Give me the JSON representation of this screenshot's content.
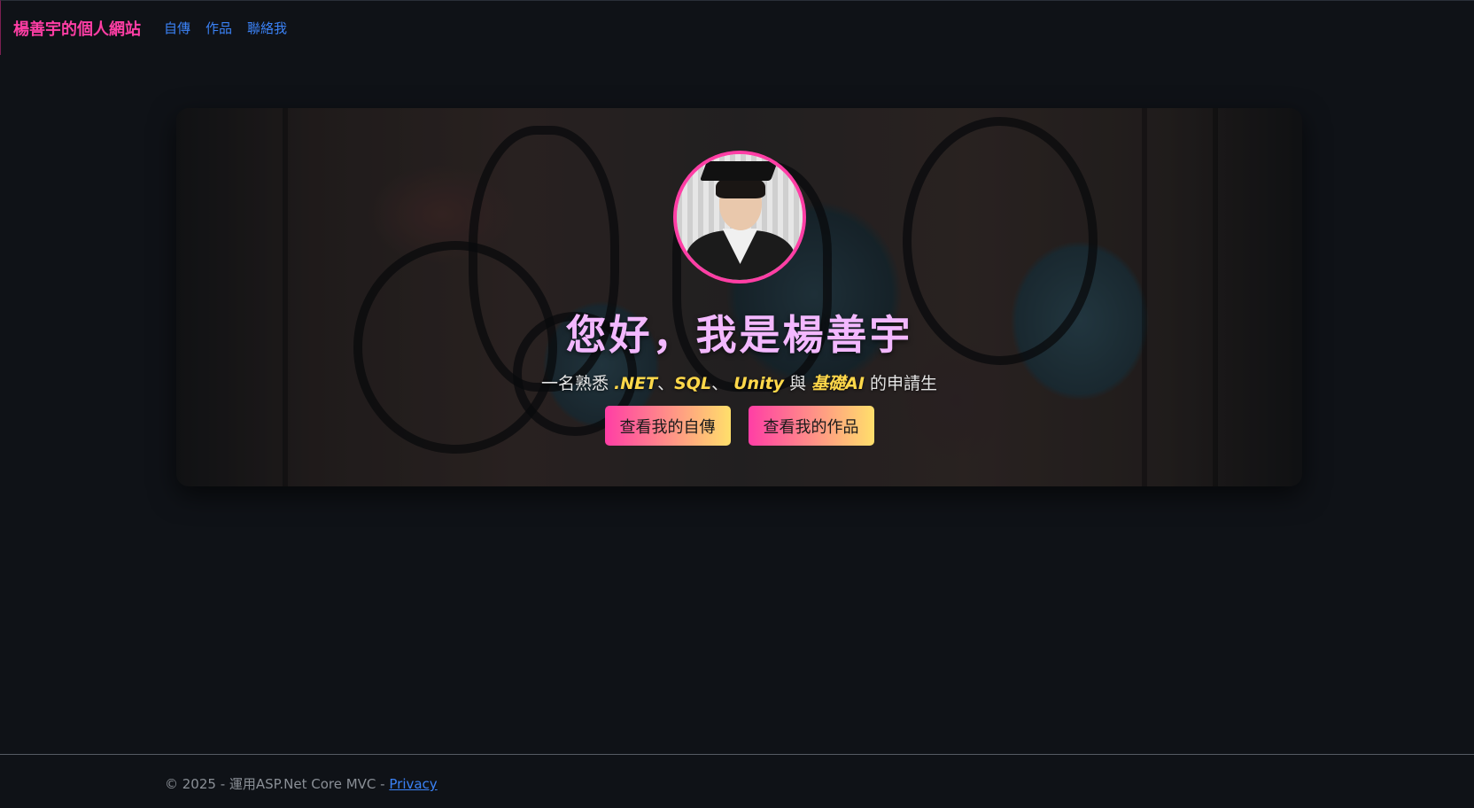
{
  "navbar": {
    "brand": "楊善宇的個人網站",
    "links": [
      "自傳",
      "作品",
      "聯絡我"
    ]
  },
  "hero": {
    "title": "您好，我是楊善宇",
    "subtitle": {
      "prefix": "一名熟悉 ",
      "skill_1": ".NET",
      "sep_1": "、",
      "skill_2": "SQL",
      "sep_2": "、 ",
      "skill_3": "Unity",
      "conj": " 與 ",
      "skill_4": "基礎AI",
      "suffix": " 的申請生"
    },
    "buttons": {
      "autobiography": "查看我的自傳",
      "works": "查看我的作品"
    }
  },
  "footer": {
    "text": "© 2025 - 運用ASP.Net Core MVC - ",
    "privacy_link": "Privacy"
  },
  "colors": {
    "accent_pink": "#ff3ea5",
    "link_blue": "#3b82f6",
    "highlight_yellow": "#ffd84a",
    "title_lilac": "#f3b8ff",
    "background": "#0f1217"
  }
}
